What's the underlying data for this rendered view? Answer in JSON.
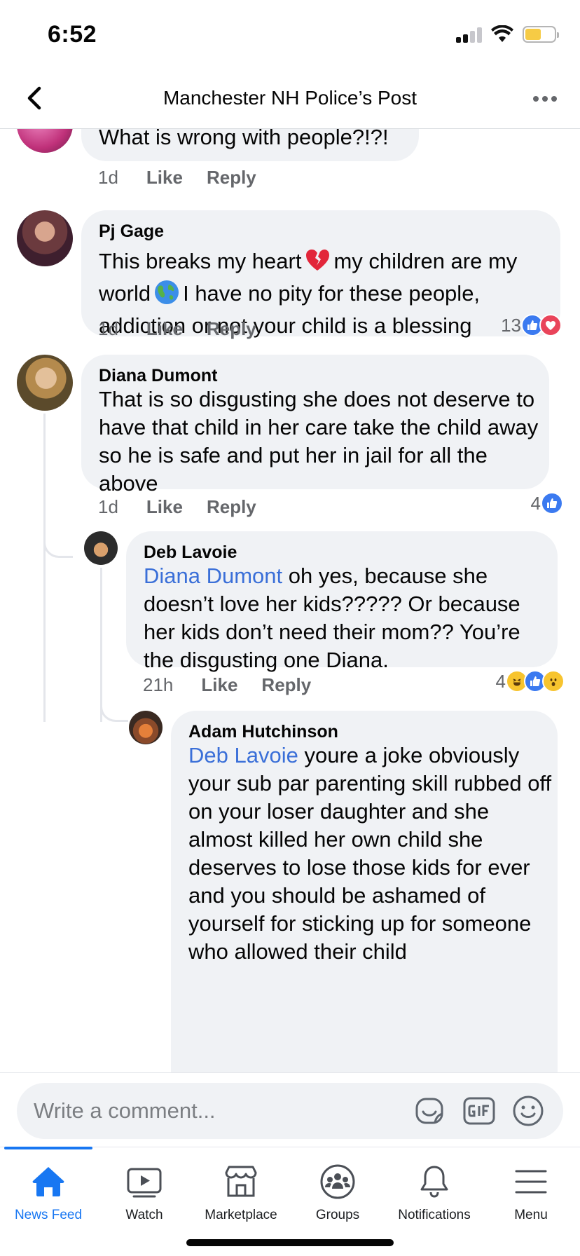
{
  "status_bar": {
    "time": "6:52"
  },
  "header": {
    "title": "Manchester NH Police’s Post"
  },
  "comments": [
    {
      "text": "What is wrong with people?!?!",
      "time": "1d",
      "like": "Like",
      "reply": "Reply"
    },
    {
      "author": "Pj Gage",
      "text_1": "This breaks my heart",
      "text_2": "my children are my world",
      "text_3": "I have no pity for these people, addiction or not your child is a blessing",
      "time": "1d",
      "like": "Like",
      "reply": "Reply",
      "reaction_count": "13",
      "reactions": [
        "like",
        "love"
      ]
    },
    {
      "author": "Diana Dumont",
      "text": "That is so disgusting she does not deserve to have that child in her care take the child away so he is safe and put her in jail for all the above",
      "time": "1d",
      "like": "Like",
      "reply": "Reply",
      "reaction_count": "4",
      "reactions": [
        "like"
      ]
    },
    {
      "author": "Deb Lavoie",
      "mention": "Diana Dumont",
      "text": "oh yes, because she doesn’t love her kids????? Or because her kids don’t need their mom?? You’re the disgusting one Diana.",
      "time": "21h",
      "like": "Like",
      "reply": "Reply",
      "reaction_count": "4",
      "reactions": [
        "haha",
        "like",
        "wow"
      ]
    },
    {
      "author": "Adam Hutchinson",
      "mention": "Deb Lavoie",
      "text": "youre a joke obviously your sub par parenting skill rubbed off on your loser daughter and she almost killed her own child she deserves to lose those kids for ever and you should be ashamed of yourself for sticking up for someone who allowed their child"
    }
  ],
  "composer": {
    "placeholder": "Write a comment..."
  },
  "tabs": [
    {
      "label": "News Feed",
      "icon": "home-icon",
      "active": true
    },
    {
      "label": "Watch",
      "icon": "watch-icon"
    },
    {
      "label": "Marketplace",
      "icon": "marketplace-icon"
    },
    {
      "label": "Groups",
      "icon": "groups-icon"
    },
    {
      "label": "Notifications",
      "icon": "bell-icon"
    },
    {
      "label": "Menu",
      "icon": "menu-icon"
    }
  ],
  "colors": {
    "accent": "#1877f2",
    "mention": "#3a6fd8",
    "bubble": "#f0f2f5",
    "secondary_text": "#65676b"
  }
}
